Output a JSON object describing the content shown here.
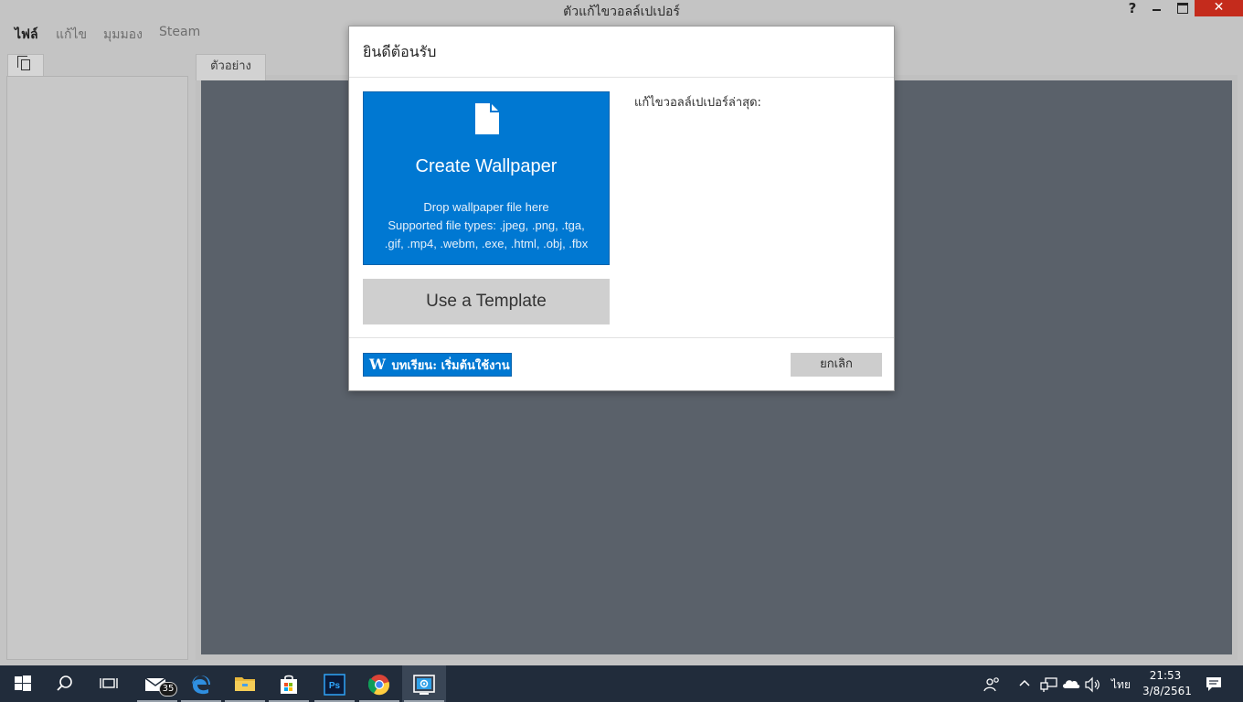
{
  "window": {
    "title": "ตัวแก้ไขวอลล์เปเปอร์",
    "help_label": "?",
    "close_label": "✕"
  },
  "menu": {
    "items": [
      {
        "label": "ไฟล์",
        "active": true
      },
      {
        "label": "แก้ไข",
        "active": false
      },
      {
        "label": "มุมมอง",
        "active": false
      },
      {
        "label": "Steam",
        "active": false
      }
    ]
  },
  "main_tab": {
    "label": "ตัวอย่าง"
  },
  "colors": {
    "accent": "#0078d2",
    "preview_bg": "#5a616a",
    "taskbar": "#212c3b",
    "close_red": "#c42b1c"
  },
  "dialog": {
    "title": "ยินดีต้อนรับ",
    "create": {
      "icon": "file-icon",
      "title": "Create Wallpaper",
      "drop_text": "Drop wallpaper file here",
      "types_line1": "Supported file types: .jpeg, .png, .tga,",
      "types_line2": ".gif, .mp4, .webm, .exe, .html, .obj, .fbx"
    },
    "template_label": "Use a Template",
    "recent_label": "แก้ไขวอลล์เปเปอร์ล่าสุด:",
    "tutorial_label": "บทเรียน: เริ่มต้นใช้งาน",
    "tutorial_icon_label": "W",
    "cancel_label": "ยกเลิก"
  },
  "taskbar": {
    "apps": [
      "start-icon",
      "search-icon",
      "task-view-icon",
      "mail-icon",
      "edge-icon",
      "file-explorer-icon",
      "store-icon",
      "photoshop-icon",
      "chrome-icon",
      "wallpaper-engine-icon"
    ],
    "mail_badge": "35",
    "photoshop_label": "Ps",
    "language": "ไทย",
    "time": "21:53",
    "date": "3/8/2561"
  }
}
